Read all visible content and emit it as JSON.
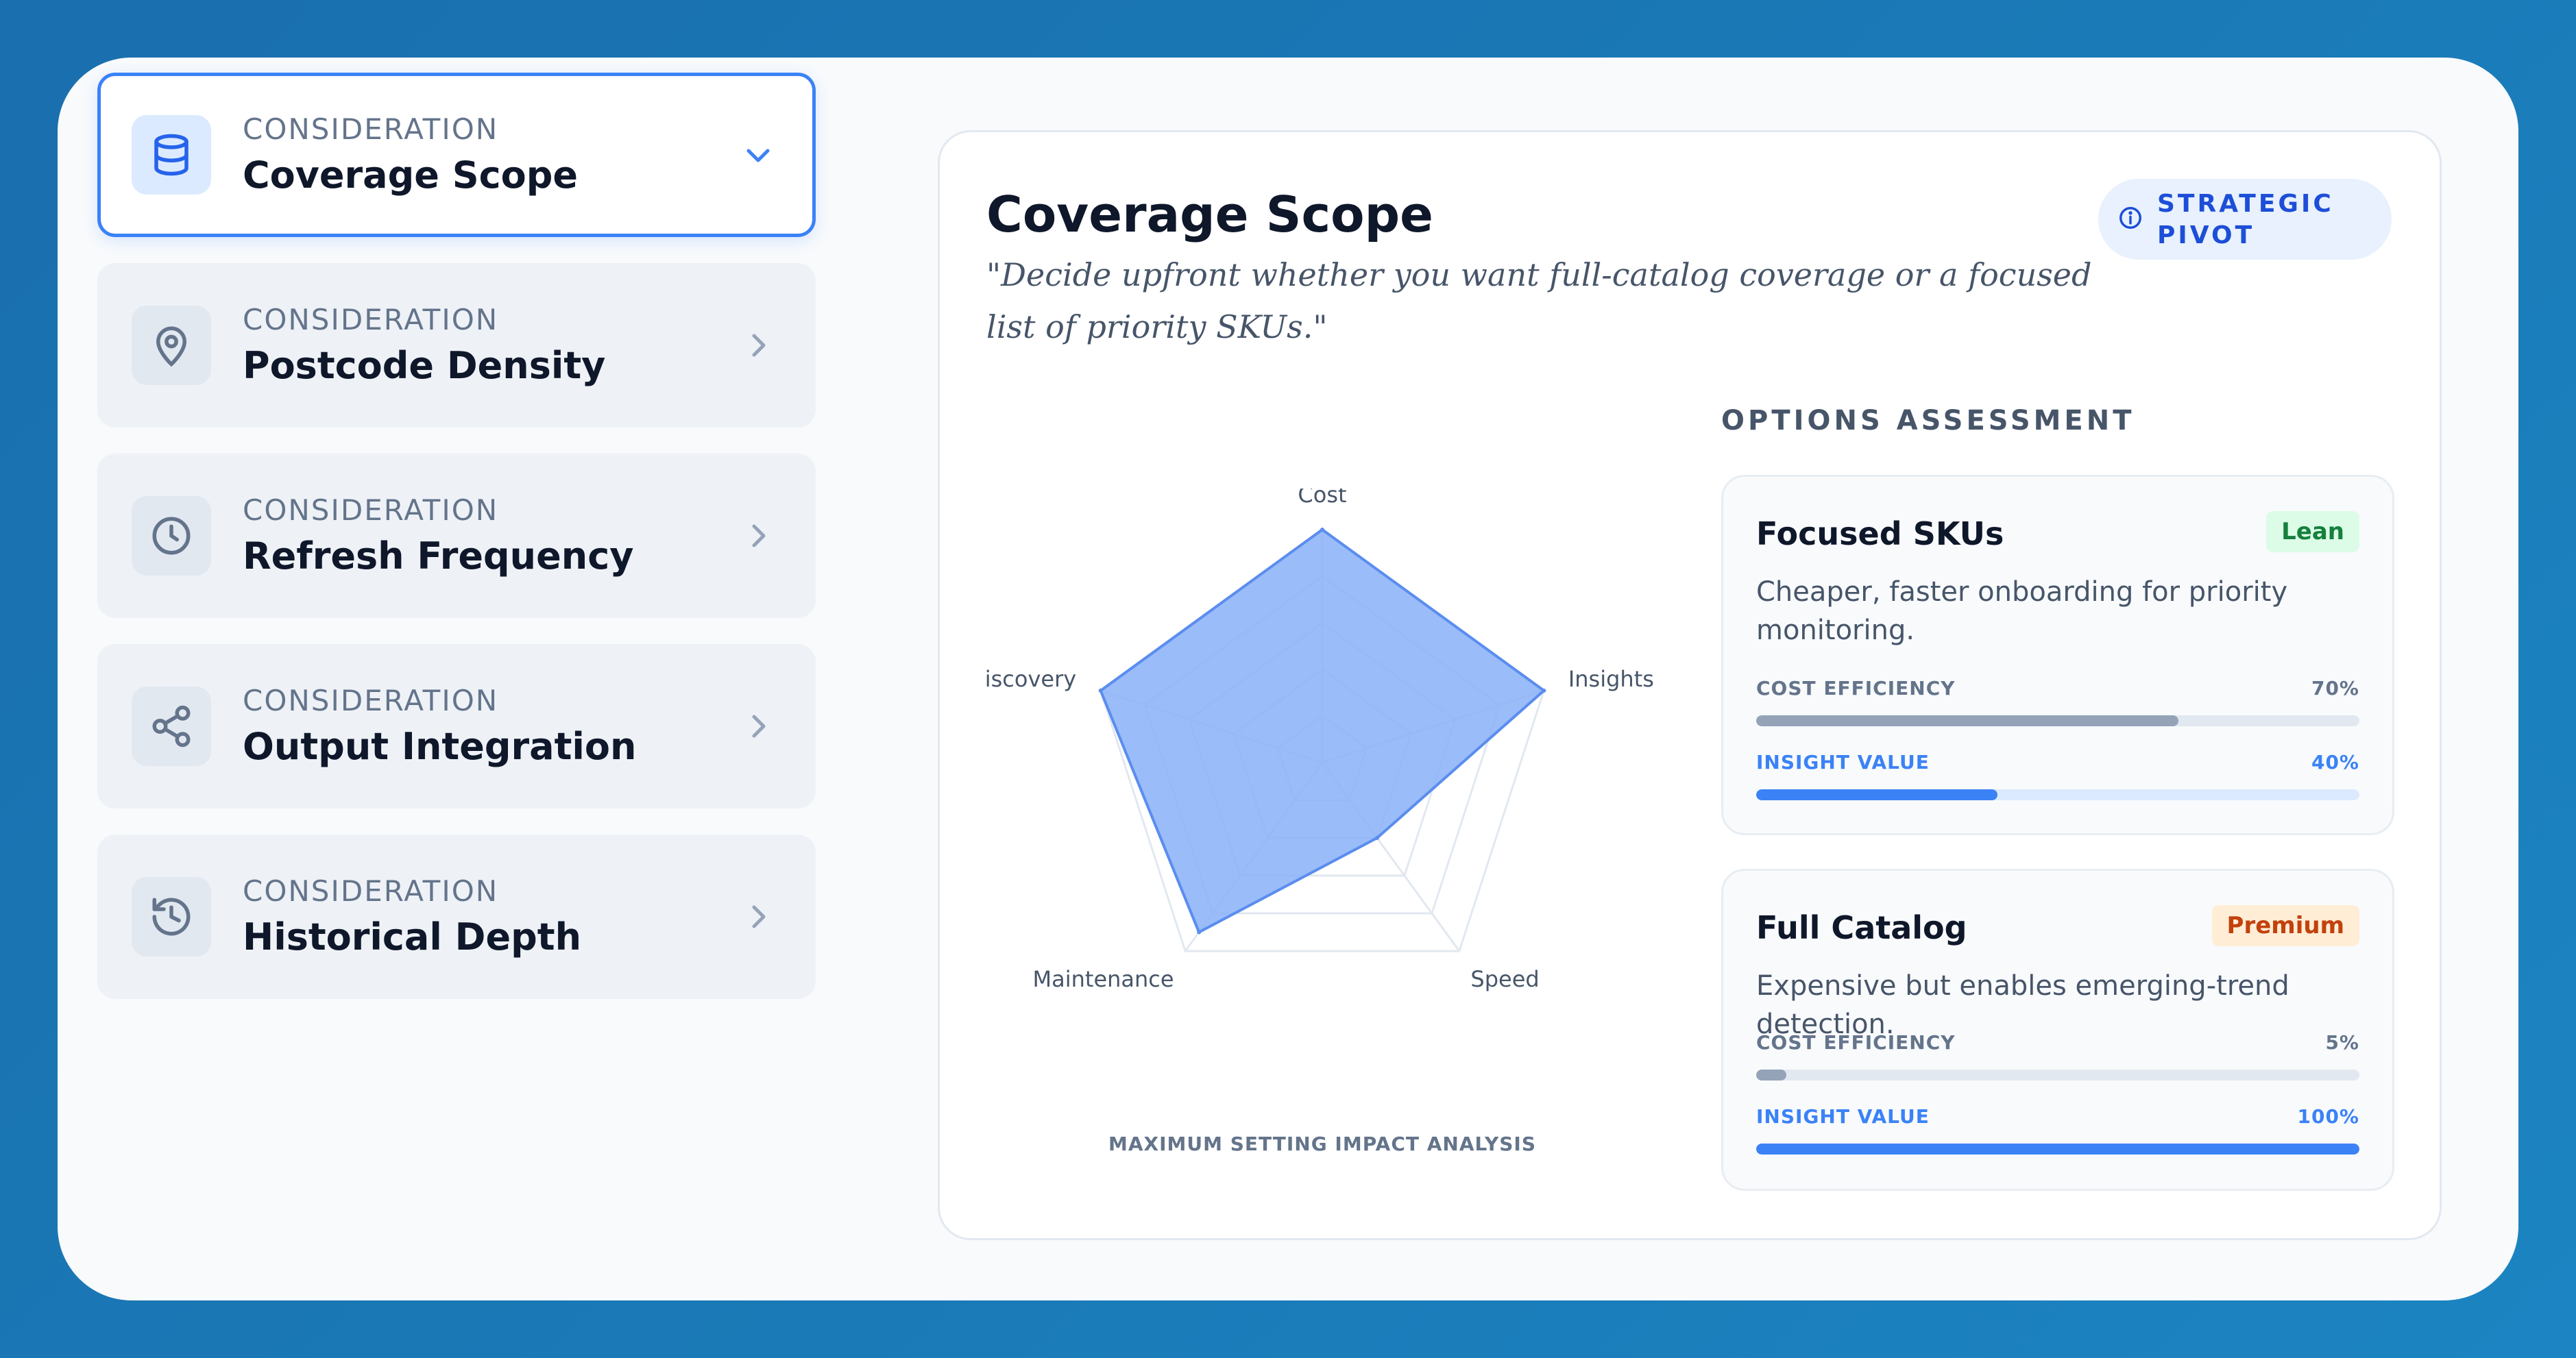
{
  "sidebar": {
    "items": [
      {
        "kicker": "CONSIDERATION",
        "label": "Coverage Scope",
        "icon": "database-icon",
        "active": true
      },
      {
        "kicker": "CONSIDERATION",
        "label": "Postcode Density",
        "icon": "map-pin-icon",
        "active": false
      },
      {
        "kicker": "CONSIDERATION",
        "label": "Refresh Frequency",
        "icon": "clock-icon",
        "active": false
      },
      {
        "kicker": "CONSIDERATION",
        "label": "Output Integration",
        "icon": "share-icon",
        "active": false
      },
      {
        "kicker": "CONSIDERATION",
        "label": "Historical Depth",
        "icon": "history-icon",
        "active": false
      }
    ]
  },
  "main": {
    "title": "Coverage Scope",
    "quote": "\"Decide upfront whether you want full-catalog coverage or a focused list of priority SKUs.\"",
    "badge": "STRATEGIC PIVOT",
    "radar_caption": "MAXIMUM SETTING IMPACT ANALYSIS",
    "options_heading": "OPTIONS ASSESSMENT",
    "options": [
      {
        "name": "Focused SKUs",
        "tag": "Lean",
        "description": "Cheaper, faster onboarding for priority monitoring.",
        "cost_label": "COST EFFICIENCY",
        "cost_value": "70%",
        "cost_fraction": 0.7,
        "insight_label": "INSIGHT VALUE",
        "insight_value": "40%",
        "insight_fraction": 0.4
      },
      {
        "name": "Full Catalog",
        "tag": "Premium",
        "description": "Expensive but enables emerging-trend detection.",
        "cost_label": "COST EFFICIENCY",
        "cost_value": "5%",
        "cost_fraction": 0.05,
        "insight_label": "INSIGHT VALUE",
        "insight_value": "100%",
        "insight_fraction": 1.0
      }
    ]
  },
  "chart_data": {
    "type": "radar",
    "axes": [
      "Cost",
      "Insights",
      "Speed",
      "Maintenance",
      "Discovery"
    ],
    "values": [
      1.0,
      1.0,
      0.4,
      0.9,
      1.0
    ],
    "range": [
      0,
      1
    ],
    "grid_rings": 5,
    "fill_color": "#8fb5f7",
    "stroke_color": "#5b8def"
  },
  "colors": {
    "accent": "#3b82f6",
    "background": "#1a79b6"
  }
}
